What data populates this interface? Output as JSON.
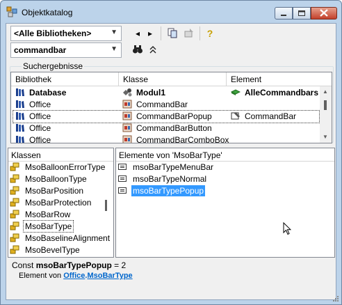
{
  "window": {
    "title": "Objektkatalog"
  },
  "toolbar": {
    "library_value": "<Alle Bibliotheken>",
    "search_value": "commandbar",
    "icons": [
      "back-icon",
      "forward-icon",
      "copy-icon",
      "view-definition-icon",
      "help-icon",
      "binoculars-icon",
      "collapse-icon"
    ]
  },
  "results": {
    "group_label": "Suchergebnisse",
    "columns": [
      "Bibliothek",
      "Klasse",
      "Element"
    ],
    "rows": [
      {
        "library": "Database",
        "class": "Modul1",
        "element": "AlleCommandbars",
        "bold": true,
        "selected": false
      },
      {
        "library": "Office",
        "class": "CommandBar",
        "element": "",
        "bold": false,
        "selected": false
      },
      {
        "library": "Office",
        "class": "CommandBarPopup",
        "element": "CommandBar",
        "bold": false,
        "selected": true
      },
      {
        "library": "Office",
        "class": "CommandBarButton",
        "element": "",
        "bold": false,
        "selected": false
      },
      {
        "library": "Office",
        "class": "CommandBarComboBox",
        "element": "",
        "bold": false,
        "selected": false
      }
    ]
  },
  "classes": {
    "header": "Klassen",
    "items": [
      "MsoBalloonErrorType",
      "MsoBalloonType",
      "MsoBarPosition",
      "MsoBarProtection",
      "MsoBarRow",
      "MsoBarType",
      "MsoBaselineAlignment",
      "MsoBevelType"
    ],
    "selected_index": 5
  },
  "members": {
    "header": "Elemente von 'MsoBarType'",
    "items": [
      "msoBarTypeMenuBar",
      "msoBarTypeNormal",
      "msoBarTypePopup"
    ],
    "selected_index": 2
  },
  "detail": {
    "prefix": "Const ",
    "name": "msoBarTypePopup",
    "suffix": " = 2",
    "member_of": "Element von ",
    "library_link": "Office",
    "dot": ".",
    "class_link": "MsoBarType"
  },
  "colors": {
    "selection": "#3399ff",
    "link": "#0066cc",
    "frame": "#bcd3ea"
  }
}
